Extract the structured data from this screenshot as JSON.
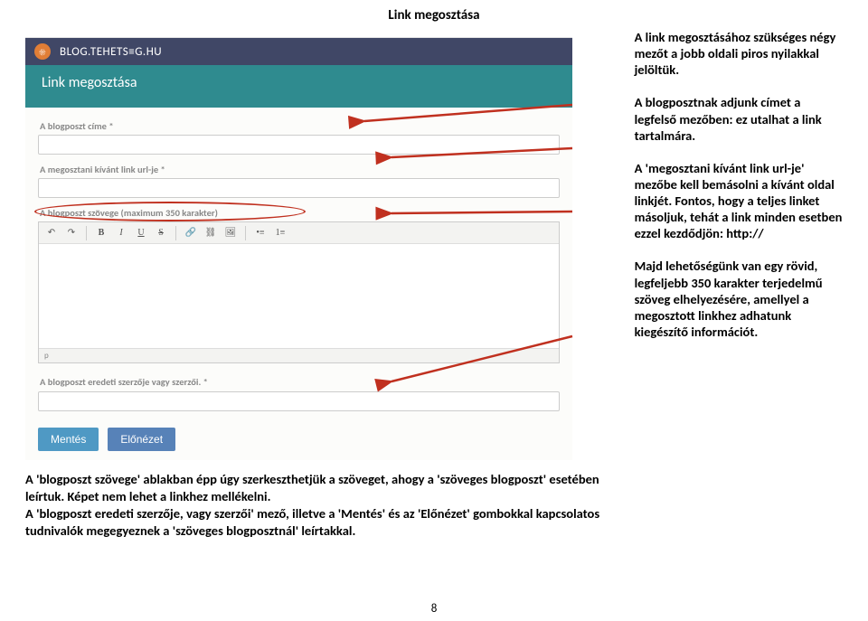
{
  "page": {
    "title": "Link megosztása",
    "number": "8"
  },
  "screenshot": {
    "site_brand": "BLOG.TEHETS≡G.HU",
    "panel_title": "Link megosztása",
    "labels": {
      "title": "A blogposzt címe *",
      "url": "A megosztani kívánt link url-je *",
      "body": "A blogposzt szövege (maximum 350 karakter)",
      "author": "A blogposzt eredeti szerzője vagy szerzői. *",
      "path_hint": "p"
    },
    "toolbar": {
      "bold": "B",
      "italic": "I",
      "underline": "U",
      "strike": "S"
    },
    "buttons": {
      "save": "Mentés",
      "preview": "Előnézet"
    }
  },
  "right": {
    "p1": "A link megosztásához szükséges négy mezőt a jobb oldali piros nyilakkal jelöltük.",
    "p2": "A blogposztnak adjunk címet a legfelső mezőben: ez utalhat a link tartalmára.",
    "p3": "A 'megosztani kívánt link url-je' mezőbe kell bemásolni a kívánt oldal linkjét. Fontos, hogy a teljes linket másoljuk, tehát a link minden esetben ezzel kezdődjön: http://",
    "p4": "Majd lehetőségünk van egy rövid, legfeljebb 350 karakter terjedelmű szöveg elhelyezésére, amellyel a megosztott linkhez adhatunk kiegészítő információt."
  },
  "caption": "A 'blogposzt szövege' ablakban épp úgy szerkeszthetjük a szöveget, ahogy a 'szöveges blogposzt' esetében leírtuk. Képet nem lehet a linkhez mellékelni.\nA 'blogposzt eredeti szerzője, vagy szerzői' mező, illetve a 'Mentés' és az 'Előnézet' gombokkal kapcsolatos tudnivalók megegyeznek a 'szöveges blogposztnál' leírtakkal."
}
